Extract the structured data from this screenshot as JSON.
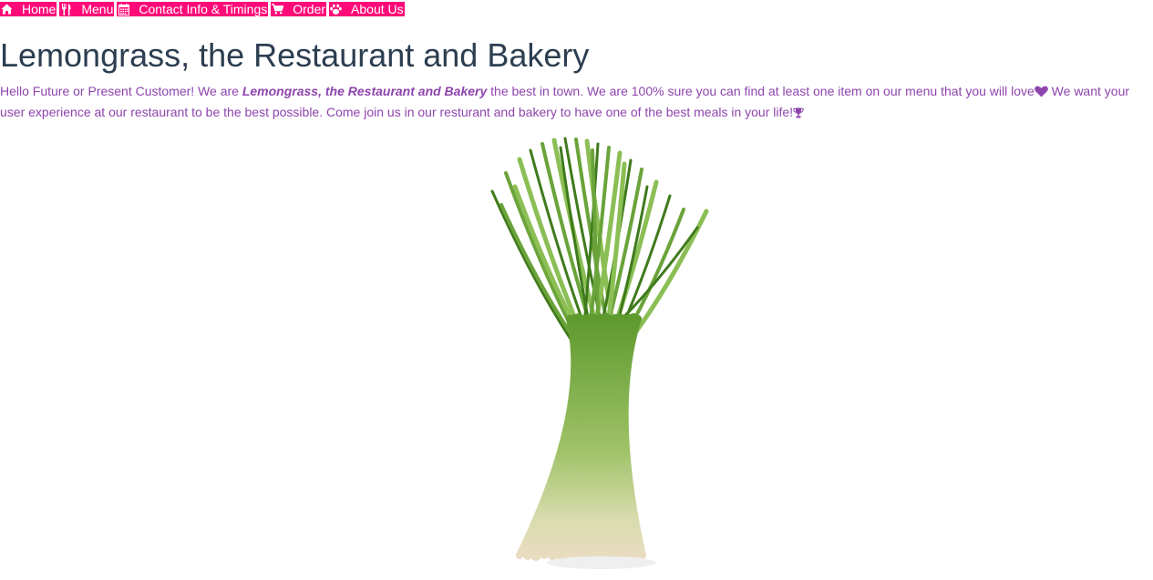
{
  "nav": {
    "items": [
      {
        "label": "Home",
        "icon": "home-icon"
      },
      {
        "label": "Menu",
        "icon": "cutlery-icon"
      },
      {
        "label": "Contact Info & Timings",
        "icon": "calendar-icon"
      },
      {
        "label": "Order",
        "icon": "cart-icon"
      },
      {
        "label": "About Us",
        "icon": "paw-icon"
      }
    ],
    "background_color": "#ff0a78",
    "text_color": "#ffffff"
  },
  "page": {
    "title": "Lemongrass, the Restaurant and Bakery",
    "title_color": "#2c3e50",
    "text_color": "#8e44ad",
    "intro_part1": "Hello Future or Present Customer! We are ",
    "intro_name": "Lemongrass, the Restaurant and Bakery",
    "intro_part2": " the best in town. We are 100% sure you can find at least one item on our menu that you will love",
    "intro_part3": " We want your user experience at our restaurant to be the best possible. Come join us in our resturant and bakery to have one of the best meals in your life!",
    "heart_icon": "heart-icon",
    "trophy_icon": "trophy-icon"
  },
  "hero": {
    "image": "lemongrass-bundle-image"
  }
}
